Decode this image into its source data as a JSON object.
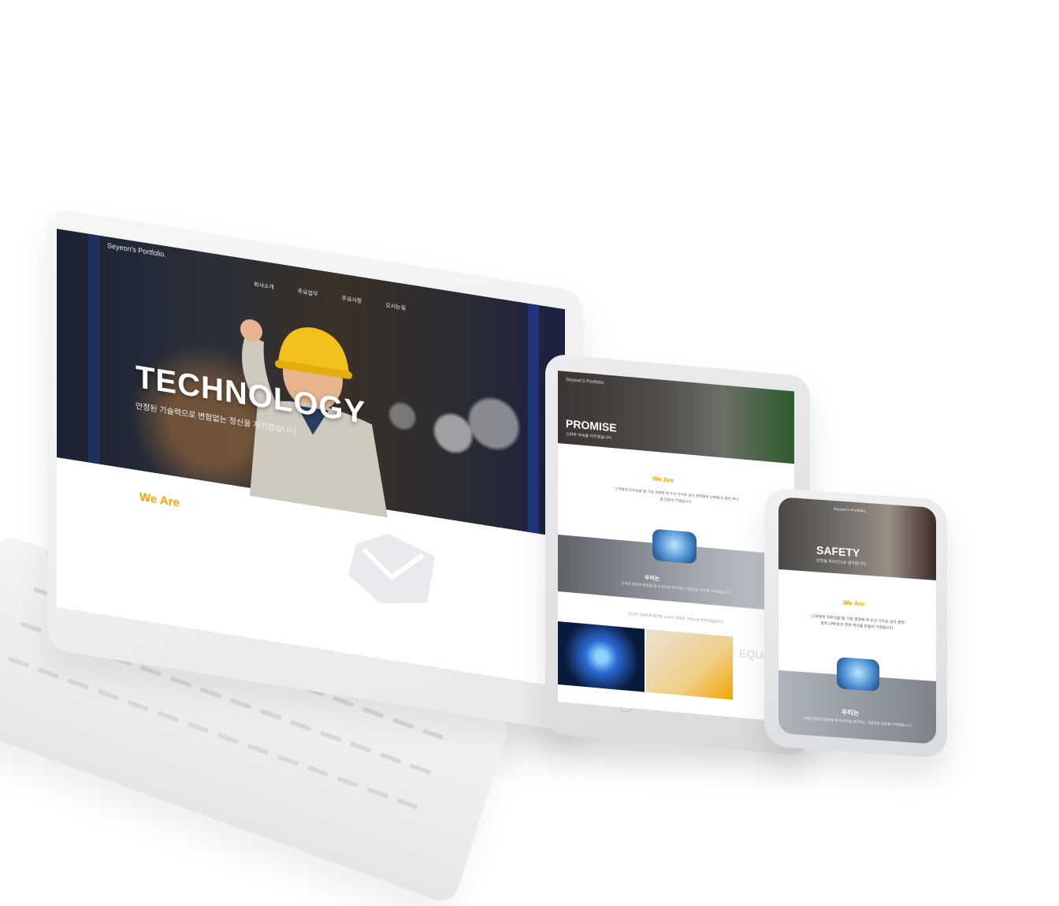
{
  "laptop": {
    "logo": "Seyeon's Portfolio.",
    "nav": [
      "회사소개",
      "주요업무",
      "주요사항",
      "오시는길"
    ],
    "hero_title": "TECHNOLOGY",
    "hero_subtitle": "안정된 기술력으로 변함없는 정신을 지키겠습니다.",
    "section_title": "We Are"
  },
  "tablet": {
    "logo": "Seyeon's Portfolio.",
    "hero_title": "PROMISE",
    "hero_subtitle": "신뢰와 약속을 지키겠습니다.",
    "section_title": "We Are",
    "intro_text": "\"고객에게 자부심을\"을 기업 경영에 제 우선 가치로 삼아 경영철학 선택에 또 한번 역사를 만들어 가겠습니다.",
    "band_title": "우리는",
    "band_text": "고객의 만족과 편안을 제 우선으로 생각하는 기업으로 최선을 다하겠습니다.",
    "footer_text": "최고의 기술력과 철저한 노하우, 최상의 서비스로 약속하겠습니다.",
    "side_label": "EQUIP"
  },
  "phone": {
    "logo": "Seyeon's Portfolio.",
    "hero_title": "SAFETY",
    "hero_subtitle": "안전을 최우선으로 생각합니다.",
    "section_title": "We Are",
    "intro_text": "\"고객에게 자부심을\"을 기업 경영에 제 우선 가치로 삼아 경영철학 선택에 또 한번 역사를 만들어 가겠습니다.",
    "band_title": "우리는",
    "band_text": "고객의 만족과 편안을 제 우선으로 생각하는 기업으로 최선을 다하겠습니다."
  },
  "colors": {
    "accent": "#f2a600",
    "device": "#ececee",
    "nav_text": "#f0f0f0"
  }
}
